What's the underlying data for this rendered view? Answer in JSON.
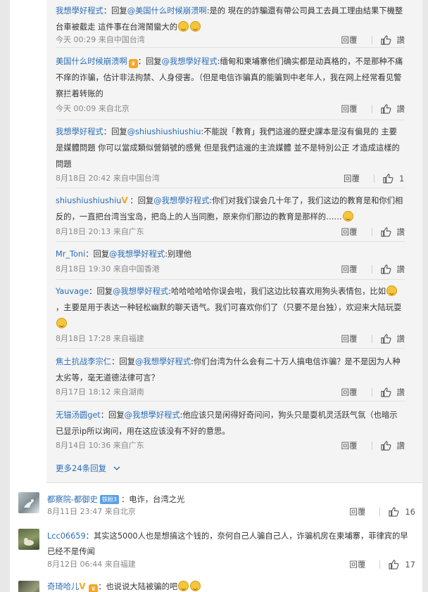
{
  "replies": [
    {
      "name": "我想學好程式",
      "prefix": "：回复",
      "at": "@美国什么时候崩溃啊",
      "text": ":是的 現在的詐騙還有帶公司員工去員工理由結果下機整台車被截走 這件事在台灣鬧蠻大的",
      "time": "今天 00:29 来自中国台湾",
      "reply_label": "回覆",
      "like_label": "讚",
      "likes": ""
    },
    {
      "name": "美国什么时候崩溃啊",
      "prefix": "：回复",
      "at": "@我想學好程式",
      "text": ":缅甸和柬埔寨他们确实都是动真格的，不是那种不痛不痒的诈骗，估计非法拘禁、人身侵害。（但是电信诈骗真的能骗到中老年人，我在网上经常看见警察拦着转账的",
      "time": "今天 00:09 来自北京",
      "reply_label": "回覆",
      "like_label": "讚",
      "likes": ""
    },
    {
      "name": "我想學好程式",
      "prefix": "：回复",
      "at": "@shiushiushiushiu",
      "text": ":不能說「教育」我們這邊的歷史課本是沒有偏見的 主要是媒體問題 你可以當成類似營銷號的感覺 但是我們這邊的主流媒體 並不是特別公正 才造成這樣的問題",
      "time": "8月18日 20:42 来自中国台湾",
      "reply_label": "回覆",
      "like_label": "",
      "likes": "1"
    },
    {
      "name": "shiushiushiushiu",
      "prefix": "：回复",
      "at": "@我想學好程式",
      "text": ":你们对我们误会几十年了，我们这边的教育是和你们相反的，一直把台湾当宝岛，把岛上的人当同胞，原来你们那边的教育是那样的……",
      "time": "8月18日 20:13 来自广东",
      "reply_label": "回覆",
      "like_label": "讚",
      "likes": ""
    },
    {
      "name": "Mr_Toni",
      "prefix": "：回复",
      "at": "@我想學好程式",
      "text": ":别理他",
      "time": "8月18日 19:30 来自中国香港",
      "reply_label": "回覆",
      "like_label": "讚",
      "likes": ""
    },
    {
      "name": "Yauvage",
      "prefix": "：回复",
      "at": "@我想學好程式",
      "text_a": ":哈哈哈哈哈你误会啦，我们这边比较喜欢用狗头表情包，比如",
      "text_b": "，主要是用于表达一种轻松幽默的聊天语气。我们可喜欢你们了（只要不是台独），欢迎来大陆玩耍",
      "time": "8月18日 17:28 来自福建",
      "reply_label": "回覆",
      "like_label": "讚",
      "likes": ""
    },
    {
      "name": "焦土抗战李宗仁",
      "prefix": "：回复",
      "at": "@我想學好程式",
      "text": ":你们台湾为什么会有二十万人搞电信诈骗？是不是因为人种太劣等，毫无道德法律可言？",
      "time": "8月17日 18:12 来自湖南",
      "reply_label": "回覆",
      "like_label": "讚",
      "likes": ""
    },
    {
      "name": "无锚汤圆get",
      "prefix": "：回复",
      "at": "@我想學好程式",
      "text": ":他应该只是闲得好奇问问，狗头只是耍机灵活跃气氛（也暗示已显示ip所以询问，用在这应该没有不好的意思。",
      "time": "8月14日 10:36 来自广东",
      "reply_label": "回覆",
      "like_label": "讚",
      "likes": ""
    }
  ],
  "more_replies": "更多24条回复",
  "top_comments": [
    {
      "name": "都察院-都御史",
      "badge": "铁粉3",
      "text": "：电诈，台湾之光",
      "time": "8月11日 23:47 来自北京",
      "reply_label": "回覆",
      "likes": "16"
    },
    {
      "name": "Lcc06659",
      "text": "：其实这5000人也是想搞这个钱的，奈何自己人骗自己人，诈骗机房在柬埔寨，菲律宾的早已经不是传闻",
      "time": "8月12日 06:44 来自福建",
      "reply_label": "回覆",
      "likes": "17"
    },
    {
      "name": "奇琦哈儿",
      "text": "：也说说大陆被骗的吧",
      "time": "",
      "reply_label": "",
      "likes": ""
    }
  ]
}
